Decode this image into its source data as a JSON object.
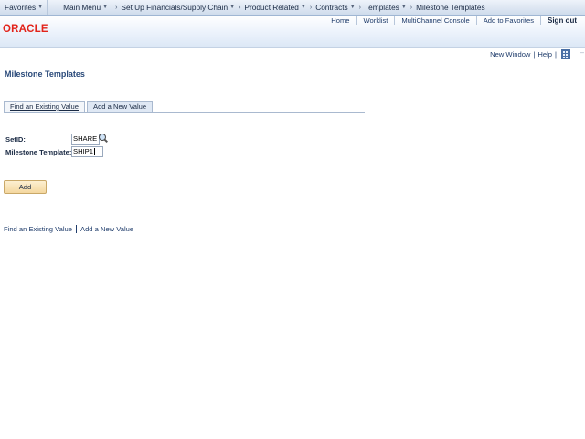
{
  "nav": {
    "favorites": "Favorites",
    "main_menu": "Main Menu",
    "breadcrumbs": [
      "Set Up Financials/Supply Chain",
      "Product Related",
      "Contracts",
      "Templates",
      "Milestone Templates"
    ]
  },
  "header": {
    "logo": "ORACLE",
    "links": [
      "Home",
      "Worklist",
      "MultiChannel Console",
      "Add to Favorites"
    ],
    "signout": "Sign out"
  },
  "util": {
    "new_window": "New Window",
    "help": "Help",
    "personalize_icon": "grid-icon"
  },
  "page": {
    "title": "Milestone Templates"
  },
  "tabs": [
    {
      "label": "Find an Existing Value",
      "active": false
    },
    {
      "label": "Add a New Value",
      "active": true
    }
  ],
  "form": {
    "setid_label": "SetID:",
    "setid_value": "SHARE",
    "template_label": "Milestone Template:",
    "template_value": "SHIP1",
    "lookup_icon": "magnifier-icon"
  },
  "buttons": {
    "add": "Add"
  },
  "bottom_links": [
    "Find an Existing Value",
    "Add a New Value"
  ]
}
